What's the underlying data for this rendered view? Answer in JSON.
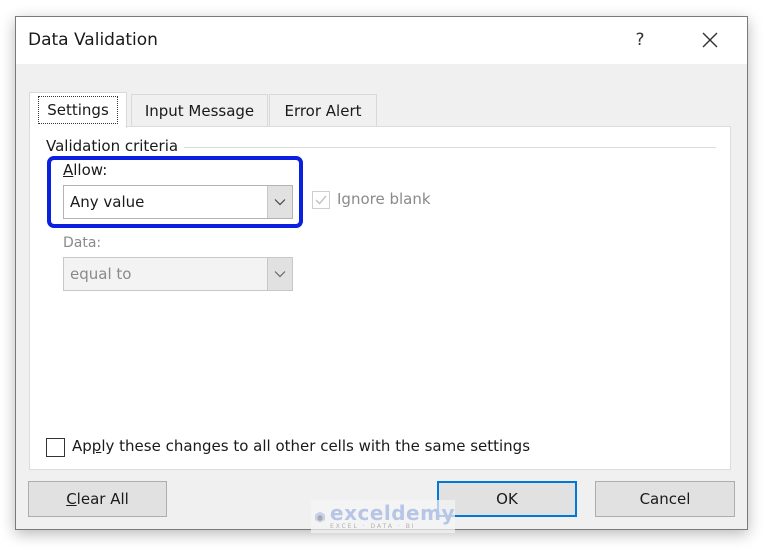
{
  "window": {
    "title": "Data Validation",
    "help_label": "?",
    "close_icon": "close-icon"
  },
  "tabs": [
    {
      "label": "Settings",
      "active": true
    },
    {
      "label": "Input Message",
      "active": false
    },
    {
      "label": "Error Alert",
      "active": false
    }
  ],
  "settings": {
    "group_label": "Validation criteria",
    "allow": {
      "label_underlined": "A",
      "label_rest": "llow:",
      "value": "Any value"
    },
    "ignore_blank": {
      "label": "Ignore blank",
      "checked": true,
      "enabled": false
    },
    "data": {
      "label": "Data:",
      "value": "equal to",
      "enabled": false
    },
    "apply_all": {
      "label_pre": "Ap",
      "label_underlined": "p",
      "label_post": "ly these changes to all other cells with the same settings",
      "checked": false
    }
  },
  "buttons": {
    "clear_all_underlined": "C",
    "clear_all_rest": "lear All",
    "ok": "OK",
    "cancel": "Cancel"
  },
  "highlight_color": "#0a1fe0",
  "watermark": {
    "name": "exceldemy",
    "tagline": "EXCEL · DATA · BI"
  }
}
